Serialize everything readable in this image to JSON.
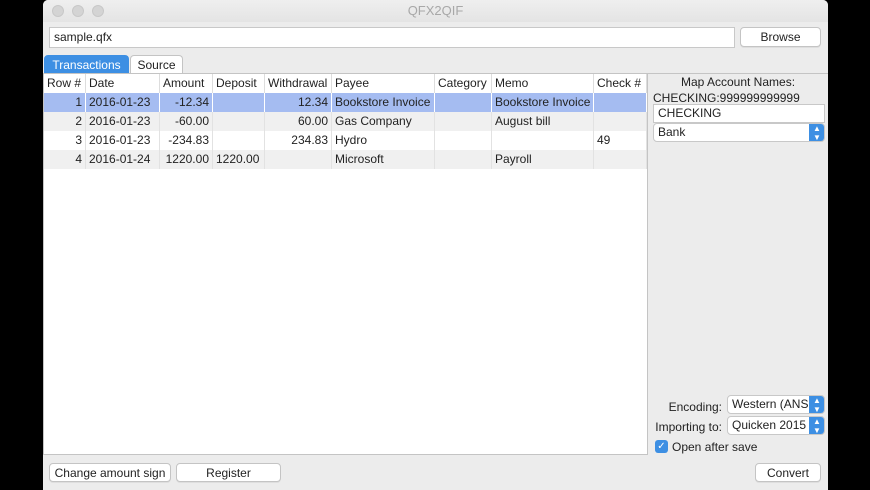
{
  "window": {
    "title": "QFX2QIF"
  },
  "file": {
    "path": "sample.qfx",
    "browse_label": "Browse"
  },
  "tabs": [
    {
      "label": "Transactions",
      "active": true
    },
    {
      "label": "Source",
      "active": false
    }
  ],
  "table": {
    "columns": [
      "Row #",
      "Date",
      "Amount",
      "Deposit",
      "Withdrawal",
      "Payee",
      "Category",
      "Memo",
      "Check #"
    ],
    "rows": [
      [
        "1",
        "2016-01-23",
        "-12.34",
        "",
        "12.34",
        "Bookstore Invoice",
        "",
        "Bookstore Invoice",
        ""
      ],
      [
        "2",
        "2016-01-23",
        "-60.00",
        "",
        "60.00",
        "Gas Company",
        "",
        "August bill",
        ""
      ],
      [
        "3",
        "2016-01-23",
        "-234.83",
        "",
        "234.83",
        "Hydro",
        "",
        "",
        "49"
      ],
      [
        "4",
        "2016-01-24",
        "1220.00",
        "1220.00",
        "",
        "Microsoft",
        "",
        "Payroll",
        ""
      ]
    ],
    "selected_row": 1
  },
  "side": {
    "map_title": "Map Account Names:",
    "account_id": "CHECKING:999999999999",
    "account_name": "CHECKING",
    "account_type": "Bank",
    "encoding_label": "Encoding:",
    "encoding_value": "Western (ANSI)",
    "importing_label": "Importing to:",
    "importing_value": "Quicken 2015",
    "open_after_save_label": "Open after save",
    "open_after_save": true
  },
  "footer": {
    "change_sign_label": "Change amount sign",
    "register_label": "Register",
    "convert_label": "Convert"
  },
  "colors": {
    "accent": "#3d8fe3",
    "selection": "#a5bcf1"
  }
}
